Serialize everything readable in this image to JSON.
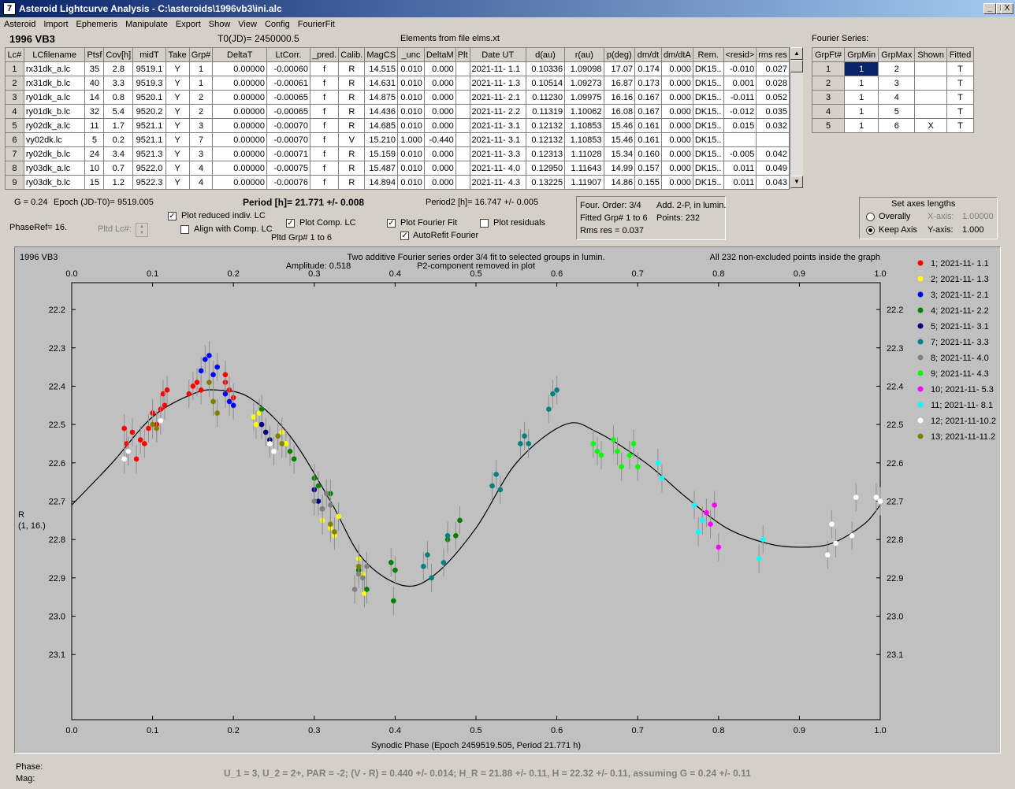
{
  "window": {
    "title": "Asteroid Lightcurve Analysis - C:\\asteroids\\1996vb3\\ini.alc",
    "icon": "7",
    "min": "_",
    "max": "□",
    "close": "X"
  },
  "menu": [
    "Asteroid",
    "Import",
    "Ephemeris",
    "Manipulate",
    "Export",
    "Show",
    "View",
    "Config",
    "FourierFit"
  ],
  "header": {
    "asteroid": "1996 VB3",
    "t0": "T0(JD)= 2450000.5",
    "elements": "Elements from file elms.xt",
    "fourier_label": "Fourier Series:"
  },
  "lc_table": {
    "columns": [
      "Lc#",
      "LCfilename",
      "Ptsf",
      "Cov[h]",
      "midT",
      "Take",
      "Grp#",
      "DeltaT",
      "LtCorr.",
      "_pred.",
      "Calib.",
      "MagCS",
      "_unc",
      "DeltaM",
      "Plt",
      "Date UT",
      "d(au)",
      "r(au)",
      "p(deg)",
      "dm/dt",
      "dm/dtA",
      "Rem.",
      "<resid>",
      "rms res"
    ],
    "rows": [
      [
        "1",
        "rx31dk_a.lc",
        "35",
        "2.8",
        "9519.1",
        "Y",
        "1",
        "0.00000",
        "-0.00060",
        "f",
        "R",
        "14.515",
        "0.010",
        "0.000",
        "",
        "2021-11- 1.1",
        "0.10336",
        "1.09098",
        "17.07",
        "0.174",
        "0.000",
        "DK15..",
        "-0.010",
        "0.027"
      ],
      [
        "2",
        "rx31dk_b.lc",
        "40",
        "3.3",
        "9519.3",
        "Y",
        "1",
        "0.00000",
        "-0.00061",
        "f",
        "R",
        "14.631",
        "0.010",
        "0.000",
        "",
        "2021-11- 1.3",
        "0.10514",
        "1.09273",
        "16.87",
        "0.173",
        "0.000",
        "DK15..",
        "0.001",
        "0.028"
      ],
      [
        "3",
        "ry01dk_a.lc",
        "14",
        "0.8",
        "9520.1",
        "Y",
        "2",
        "0.00000",
        "-0.00065",
        "f",
        "R",
        "14.875",
        "0.010",
        "0.000",
        "",
        "2021-11- 2.1",
        "0.11230",
        "1.09975",
        "16.16",
        "0.167",
        "0.000",
        "DK15..",
        "-0.011",
        "0.052"
      ],
      [
        "4",
        "ry01dk_b.lc",
        "32",
        "5.4",
        "9520.2",
        "Y",
        "2",
        "0.00000",
        "-0.00065",
        "f",
        "R",
        "14.436",
        "0.010",
        "0.000",
        "",
        "2021-11- 2.2",
        "0.11319",
        "1.10062",
        "16.08",
        "0.167",
        "0.000",
        "DK15..",
        "-0.012",
        "0.035"
      ],
      [
        "5",
        "ry02dk_a.lc",
        "11",
        "1.7",
        "9521.1",
        "Y",
        "3",
        "0.00000",
        "-0.00070",
        "f",
        "R",
        "14.685",
        "0.010",
        "0.000",
        "",
        "2021-11- 3.1",
        "0.12132",
        "1.10853",
        "15.46",
        "0.161",
        "0.000",
        "DK15..",
        "0.015",
        "0.032"
      ],
      [
        "6",
        "vy02dk.lc",
        "5",
        "0.2",
        "9521.1",
        "Y",
        "7",
        "0.00000",
        "-0.00070",
        "f",
        "V",
        "15.210",
        "1.000",
        "-0.440",
        "",
        "2021-11- 3.1",
        "0.12132",
        "1.10853",
        "15.46",
        "0.161",
        "0.000",
        "DK15..",
        "",
        ""
      ],
      [
        "7",
        "ry02dk_b.lc",
        "24",
        "3.4",
        "9521.3",
        "Y",
        "3",
        "0.00000",
        "-0.00071",
        "f",
        "R",
        "15.159",
        "0.010",
        "0.000",
        "",
        "2021-11- 3.3",
        "0.12313",
        "1.11028",
        "15.34",
        "0.160",
        "0.000",
        "DK15..",
        "-0.005",
        "0.042"
      ],
      [
        "8",
        "ry03dk_a.lc",
        "10",
        "0.7",
        "9522.0",
        "Y",
        "4",
        "0.00000",
        "-0.00075",
        "f",
        "R",
        "15.487",
        "0.010",
        "0.000",
        "",
        "2021-11- 4.0",
        "0.12950",
        "1.11643",
        "14.99",
        "0.157",
        "0.000",
        "DK15..",
        "0.011",
        "0.049"
      ],
      [
        "9",
        "ry03dk_b.lc",
        "15",
        "1.2",
        "9522.3",
        "Y",
        "4",
        "0.00000",
        "-0.00076",
        "f",
        "R",
        "14.894",
        "0.010",
        "0.000",
        "",
        "2021-11- 4.3",
        "0.13225",
        "1.11907",
        "14.86",
        "0.155",
        "0.000",
        "DK15..",
        "0.011",
        "0.043"
      ]
    ]
  },
  "fourier_table": {
    "columns": [
      "GrpFt#",
      "GrpMin",
      "GrpMax",
      "Shown",
      "Fitted"
    ],
    "rows": [
      [
        "1",
        "1",
        "2",
        "",
        "T"
      ],
      [
        "2",
        "1",
        "3",
        "",
        "T"
      ],
      [
        "3",
        "1",
        "4",
        "",
        "T"
      ],
      [
        "4",
        "1",
        "5",
        "",
        "T"
      ],
      [
        "5",
        "1",
        "6",
        "X",
        "T"
      ]
    ]
  },
  "info": {
    "g": "G = 0.24",
    "epoch": "Epoch (JD-T0)= 9519.005",
    "period": "Period [h]= 21.771 +/- 0.008",
    "period2": "Period2 [h]= 16.747 +/- 0.005",
    "phaseref": "PhaseRef= 16.",
    "pltd_lc": "Pltd Lc#:",
    "pltd_grp": "Pltd Grp#  1   to   6"
  },
  "options": {
    "plot_reduced": "Plot reduced indiv. LC",
    "align": "Align with Comp. LC",
    "plot_comp": "Plot Comp. LC",
    "plot_fourier": "Plot Fourier Fit",
    "autorefit": "AutoRefit Fourier",
    "plot_residuals": "Plot residuals"
  },
  "fourier_info": {
    "order": "Four. Order:  3/4",
    "add": "Add. 2-P, in lumin.",
    "fitted": "Fitted Grp# 1 to 6",
    "points": "Points: 232",
    "rms": "Rms res     = 0.037"
  },
  "axes": {
    "title": "Set axes lengths",
    "overall": "Overally",
    "keep": "Keep Axis",
    "xaxis_label": "X-axis:",
    "xaxis_val": "1.00000",
    "yaxis_label": "Y-axis:",
    "yaxis_val": "1.000"
  },
  "status": {
    "phase": "Phase:",
    "mag": "Mag:",
    "summary": "U_1 = 3, U_2 = 2+, PAR = -2; (V - R) = 0.440 +/- 0.014; H_R = 21.88 +/- 0.11, H = 22.32 +/- 0.11, assuming G = 0.24 +/- 0.11"
  },
  "chart_data": {
    "type": "scatter",
    "title": "Two additive Fourier series order 3/4 fit to selected groups in lumin.",
    "subtitle_left": "Amplitude: 0.518",
    "subtitle_right": "P2-component removed in plot",
    "corner_left": "1996 VB3",
    "corner_right": "All 232 non-excluded points inside the graph",
    "xlabel": "Synodic Phase (Epoch 2459519.505, Period 21.771 h)",
    "ylabel": "R",
    "ylabel2": "(1, 16.)",
    "xlim": [
      0,
      1
    ],
    "ylim": [
      22.13,
      23.27
    ],
    "xticks": [
      "0.0",
      "0.1",
      "0.2",
      "0.3",
      "0.4",
      "0.5",
      "0.6",
      "0.7",
      "0.8",
      "0.9",
      "1.0"
    ],
    "yticks": [
      "22.2",
      "22.3",
      "22.4",
      "22.5",
      "22.6",
      "22.7",
      "22.8",
      "22.9",
      "23.0",
      "23.1"
    ],
    "fit": [
      [
        0,
        22.71
      ],
      [
        0.05,
        22.6
      ],
      [
        0.1,
        22.48
      ],
      [
        0.15,
        22.42
      ],
      [
        0.18,
        22.41
      ],
      [
        0.22,
        22.43
      ],
      [
        0.27,
        22.53
      ],
      [
        0.32,
        22.7
      ],
      [
        0.36,
        22.85
      ],
      [
        0.41,
        22.92
      ],
      [
        0.45,
        22.89
      ],
      [
        0.5,
        22.77
      ],
      [
        0.55,
        22.6
      ],
      [
        0.61,
        22.5
      ],
      [
        0.65,
        22.52
      ],
      [
        0.71,
        22.6
      ],
      [
        0.76,
        22.69
      ],
      [
        0.81,
        22.77
      ],
      [
        0.86,
        22.81
      ],
      [
        0.9,
        22.82
      ],
      [
        0.94,
        22.81
      ],
      [
        0.98,
        22.76
      ],
      [
        1,
        22.71
      ]
    ],
    "series": [
      {
        "name": "1; 2021-11- 1.1",
        "color": "#ff0000",
        "points": [
          [
            0.065,
            22.51
          ],
          [
            0.068,
            22.55
          ],
          [
            0.07,
            22.57
          ],
          [
            0.075,
            22.52
          ],
          [
            0.08,
            22.59
          ],
          [
            0.085,
            22.54
          ],
          [
            0.09,
            22.55
          ],
          [
            0.095,
            22.51
          ],
          [
            0.1,
            22.47
          ],
          [
            0.105,
            22.5
          ],
          [
            0.11,
            22.46
          ],
          [
            0.113,
            22.42
          ],
          [
            0.115,
            22.45
          ],
          [
            0.118,
            22.41
          ],
          [
            0.145,
            22.42
          ],
          [
            0.15,
            22.4
          ],
          [
            0.155,
            22.39
          ],
          [
            0.16,
            22.41
          ],
          [
            0.19,
            22.39
          ],
          [
            0.195,
            22.41
          ],
          [
            0.2,
            22.43
          ],
          [
            0.19,
            22.37
          ]
        ]
      },
      {
        "name": "2; 2021-11- 1.3",
        "color": "#ffff00",
        "points": [
          [
            0.225,
            22.48
          ],
          [
            0.228,
            22.5
          ],
          [
            0.232,
            22.47
          ],
          [
            0.26,
            22.52
          ],
          [
            0.265,
            22.55
          ],
          [
            0.27,
            22.57
          ],
          [
            0.31,
            22.75
          ],
          [
            0.32,
            22.77
          ],
          [
            0.325,
            22.79
          ],
          [
            0.33,
            22.74
          ],
          [
            0.355,
            22.85
          ],
          [
            0.36,
            22.89
          ],
          [
            0.362,
            22.94
          ]
        ]
      },
      {
        "name": "3; 2021-11- 2.1",
        "color": "#0000ff",
        "points": [
          [
            0.16,
            22.36
          ],
          [
            0.165,
            22.33
          ],
          [
            0.17,
            22.32
          ],
          [
            0.175,
            22.37
          ],
          [
            0.18,
            22.35
          ],
          [
            0.19,
            22.42
          ],
          [
            0.195,
            22.44
          ],
          [
            0.2,
            22.45
          ]
        ]
      },
      {
        "name": "4; 2021-11- 2.2",
        "color": "#008000",
        "points": [
          [
            0.235,
            22.46
          ],
          [
            0.27,
            22.57
          ],
          [
            0.275,
            22.59
          ],
          [
            0.3,
            22.64
          ],
          [
            0.305,
            22.66
          ],
          [
            0.32,
            22.68
          ],
          [
            0.355,
            22.88
          ],
          [
            0.365,
            22.93
          ],
          [
            0.395,
            22.86
          ],
          [
            0.4,
            22.88
          ],
          [
            0.398,
            22.96
          ],
          [
            0.465,
            22.8
          ],
          [
            0.475,
            22.79
          ],
          [
            0.48,
            22.75
          ]
        ]
      },
      {
        "name": "5; 2021-11- 3.1",
        "color": "#000080",
        "points": [
          [
            0.235,
            22.5
          ],
          [
            0.24,
            22.52
          ],
          [
            0.245,
            22.54
          ],
          [
            0.3,
            22.67
          ],
          [
            0.305,
            22.7
          ],
          [
            0.31,
            22.72
          ]
        ]
      },
      {
        "name": "7; 2021-11- 3.3",
        "color": "#008080",
        "points": [
          [
            0.435,
            22.87
          ],
          [
            0.44,
            22.84
          ],
          [
            0.445,
            22.9
          ],
          [
            0.46,
            22.86
          ],
          [
            0.465,
            22.79
          ],
          [
            0.52,
            22.66
          ],
          [
            0.525,
            22.63
          ],
          [
            0.53,
            22.67
          ],
          [
            0.555,
            22.55
          ],
          [
            0.56,
            22.53
          ],
          [
            0.565,
            22.55
          ],
          [
            0.59,
            22.46
          ],
          [
            0.595,
            22.42
          ],
          [
            0.6,
            22.41
          ]
        ]
      },
      {
        "name": "8; 2021-11- 4.0",
        "color": "#808080",
        "points": [
          [
            0.3,
            22.7
          ],
          [
            0.31,
            22.72
          ],
          [
            0.315,
            22.68
          ],
          [
            0.32,
            22.71
          ],
          [
            0.35,
            22.93
          ],
          [
            0.355,
            22.89
          ],
          [
            0.36,
            22.9
          ],
          [
            0.365,
            22.87
          ]
        ]
      },
      {
        "name": "9; 2021-11- 4.3",
        "color": "#00ff00",
        "points": [
          [
            0.645,
            22.55
          ],
          [
            0.65,
            22.57
          ],
          [
            0.655,
            22.58
          ],
          [
            0.67,
            22.54
          ],
          [
            0.675,
            22.57
          ],
          [
            0.68,
            22.61
          ],
          [
            0.69,
            22.58
          ],
          [
            0.695,
            22.55
          ],
          [
            0.7,
            22.61
          ]
        ]
      },
      {
        "name": "10; 2021-11- 5.3",
        "color": "#ff00ff",
        "points": [
          [
            0.785,
            22.73
          ],
          [
            0.79,
            22.76
          ],
          [
            0.795,
            22.71
          ],
          [
            0.8,
            22.82
          ]
        ]
      },
      {
        "name": "11; 2021-11- 8.1",
        "color": "#00ffff",
        "points": [
          [
            0.725,
            22.6
          ],
          [
            0.73,
            22.64
          ],
          [
            0.77,
            22.71
          ],
          [
            0.775,
            22.78
          ],
          [
            0.78,
            22.75
          ],
          [
            0.85,
            22.85
          ],
          [
            0.855,
            22.8
          ]
        ]
      },
      {
        "name": "12; 2021-11-10.2",
        "color": "#ffffff",
        "points": [
          [
            0.065,
            22.59
          ],
          [
            0.07,
            22.57
          ],
          [
            0.105,
            22.51
          ],
          [
            0.11,
            22.49
          ],
          [
            0.245,
            22.55
          ],
          [
            0.25,
            22.57
          ],
          [
            0.935,
            22.84
          ],
          [
            0.94,
            22.76
          ],
          [
            0.945,
            22.81
          ],
          [
            0.965,
            22.79
          ],
          [
            0.97,
            22.69
          ],
          [
            1.0,
            22.7
          ],
          [
            0.995,
            22.69
          ]
        ]
      },
      {
        "name": "13; 2021-11-11.2",
        "color": "#808000",
        "points": [
          [
            0.1,
            22.5
          ],
          [
            0.105,
            22.51
          ],
          [
            0.17,
            22.39
          ],
          [
            0.175,
            22.44
          ],
          [
            0.18,
            22.47
          ],
          [
            0.255,
            22.53
          ],
          [
            0.26,
            22.55
          ],
          [
            0.32,
            22.76
          ],
          [
            0.325,
            22.78
          ],
          [
            0.355,
            22.87
          ]
        ]
      }
    ]
  }
}
